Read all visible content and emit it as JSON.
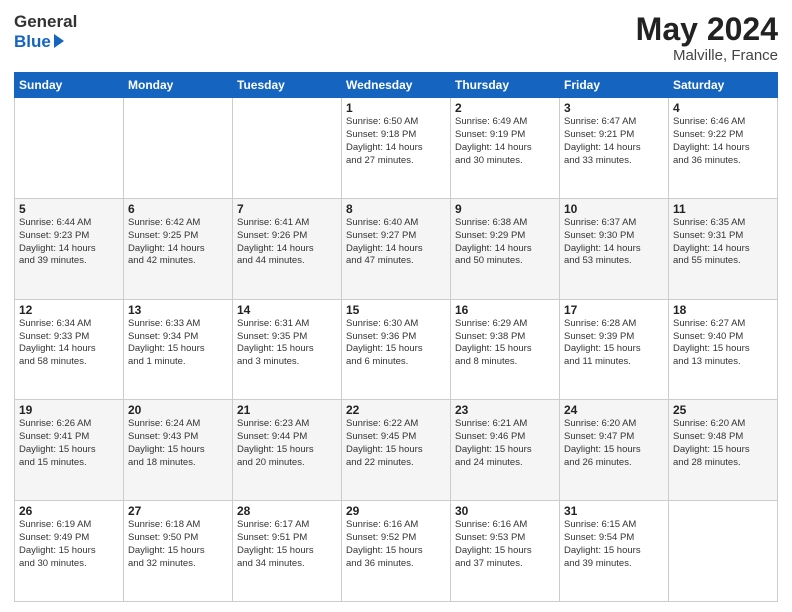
{
  "header": {
    "logo_general": "General",
    "logo_blue": "Blue",
    "title": "May 2024",
    "location": "Malville, France"
  },
  "weekdays": [
    "Sunday",
    "Monday",
    "Tuesday",
    "Wednesday",
    "Thursday",
    "Friday",
    "Saturday"
  ],
  "weeks": [
    [
      {
        "day": "",
        "info": ""
      },
      {
        "day": "",
        "info": ""
      },
      {
        "day": "",
        "info": ""
      },
      {
        "day": "1",
        "info": "Sunrise: 6:50 AM\nSunset: 9:18 PM\nDaylight: 14 hours\nand 27 minutes."
      },
      {
        "day": "2",
        "info": "Sunrise: 6:49 AM\nSunset: 9:19 PM\nDaylight: 14 hours\nand 30 minutes."
      },
      {
        "day": "3",
        "info": "Sunrise: 6:47 AM\nSunset: 9:21 PM\nDaylight: 14 hours\nand 33 minutes."
      },
      {
        "day": "4",
        "info": "Sunrise: 6:46 AM\nSunset: 9:22 PM\nDaylight: 14 hours\nand 36 minutes."
      }
    ],
    [
      {
        "day": "5",
        "info": "Sunrise: 6:44 AM\nSunset: 9:23 PM\nDaylight: 14 hours\nand 39 minutes."
      },
      {
        "day": "6",
        "info": "Sunrise: 6:42 AM\nSunset: 9:25 PM\nDaylight: 14 hours\nand 42 minutes."
      },
      {
        "day": "7",
        "info": "Sunrise: 6:41 AM\nSunset: 9:26 PM\nDaylight: 14 hours\nand 44 minutes."
      },
      {
        "day": "8",
        "info": "Sunrise: 6:40 AM\nSunset: 9:27 PM\nDaylight: 14 hours\nand 47 minutes."
      },
      {
        "day": "9",
        "info": "Sunrise: 6:38 AM\nSunset: 9:29 PM\nDaylight: 14 hours\nand 50 minutes."
      },
      {
        "day": "10",
        "info": "Sunrise: 6:37 AM\nSunset: 9:30 PM\nDaylight: 14 hours\nand 53 minutes."
      },
      {
        "day": "11",
        "info": "Sunrise: 6:35 AM\nSunset: 9:31 PM\nDaylight: 14 hours\nand 55 minutes."
      }
    ],
    [
      {
        "day": "12",
        "info": "Sunrise: 6:34 AM\nSunset: 9:33 PM\nDaylight: 14 hours\nand 58 minutes."
      },
      {
        "day": "13",
        "info": "Sunrise: 6:33 AM\nSunset: 9:34 PM\nDaylight: 15 hours\nand 1 minute."
      },
      {
        "day": "14",
        "info": "Sunrise: 6:31 AM\nSunset: 9:35 PM\nDaylight: 15 hours\nand 3 minutes."
      },
      {
        "day": "15",
        "info": "Sunrise: 6:30 AM\nSunset: 9:36 PM\nDaylight: 15 hours\nand 6 minutes."
      },
      {
        "day": "16",
        "info": "Sunrise: 6:29 AM\nSunset: 9:38 PM\nDaylight: 15 hours\nand 8 minutes."
      },
      {
        "day": "17",
        "info": "Sunrise: 6:28 AM\nSunset: 9:39 PM\nDaylight: 15 hours\nand 11 minutes."
      },
      {
        "day": "18",
        "info": "Sunrise: 6:27 AM\nSunset: 9:40 PM\nDaylight: 15 hours\nand 13 minutes."
      }
    ],
    [
      {
        "day": "19",
        "info": "Sunrise: 6:26 AM\nSunset: 9:41 PM\nDaylight: 15 hours\nand 15 minutes."
      },
      {
        "day": "20",
        "info": "Sunrise: 6:24 AM\nSunset: 9:43 PM\nDaylight: 15 hours\nand 18 minutes."
      },
      {
        "day": "21",
        "info": "Sunrise: 6:23 AM\nSunset: 9:44 PM\nDaylight: 15 hours\nand 20 minutes."
      },
      {
        "day": "22",
        "info": "Sunrise: 6:22 AM\nSunset: 9:45 PM\nDaylight: 15 hours\nand 22 minutes."
      },
      {
        "day": "23",
        "info": "Sunrise: 6:21 AM\nSunset: 9:46 PM\nDaylight: 15 hours\nand 24 minutes."
      },
      {
        "day": "24",
        "info": "Sunrise: 6:20 AM\nSunset: 9:47 PM\nDaylight: 15 hours\nand 26 minutes."
      },
      {
        "day": "25",
        "info": "Sunrise: 6:20 AM\nSunset: 9:48 PM\nDaylight: 15 hours\nand 28 minutes."
      }
    ],
    [
      {
        "day": "26",
        "info": "Sunrise: 6:19 AM\nSunset: 9:49 PM\nDaylight: 15 hours\nand 30 minutes."
      },
      {
        "day": "27",
        "info": "Sunrise: 6:18 AM\nSunset: 9:50 PM\nDaylight: 15 hours\nand 32 minutes."
      },
      {
        "day": "28",
        "info": "Sunrise: 6:17 AM\nSunset: 9:51 PM\nDaylight: 15 hours\nand 34 minutes."
      },
      {
        "day": "29",
        "info": "Sunrise: 6:16 AM\nSunset: 9:52 PM\nDaylight: 15 hours\nand 36 minutes."
      },
      {
        "day": "30",
        "info": "Sunrise: 6:16 AM\nSunset: 9:53 PM\nDaylight: 15 hours\nand 37 minutes."
      },
      {
        "day": "31",
        "info": "Sunrise: 6:15 AM\nSunset: 9:54 PM\nDaylight: 15 hours\nand 39 minutes."
      },
      {
        "day": "",
        "info": ""
      }
    ]
  ]
}
